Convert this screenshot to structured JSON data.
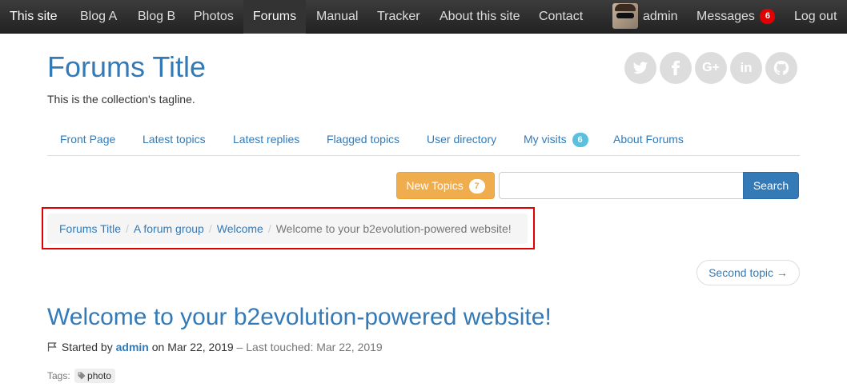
{
  "navbar": {
    "brand": "This site",
    "items": [
      "Blog A",
      "Blog B",
      "Photos",
      "Forums",
      "Manual",
      "Tracker",
      "About this site",
      "Contact"
    ],
    "active": "Forums",
    "user": "admin",
    "messages_label": "Messages",
    "messages_count": "6",
    "logout": "Log out"
  },
  "header": {
    "title": "Forums Title",
    "tagline": "This is the collection's tagline.",
    "social": [
      "twitter-icon",
      "facebook-icon",
      "google-plus-icon",
      "linkedin-icon",
      "github-icon"
    ]
  },
  "tabs": {
    "items": [
      "Front Page",
      "Latest topics",
      "Latest replies",
      "Flagged topics",
      "User directory",
      "My visits",
      "About Forums"
    ],
    "my_visits_count": "6"
  },
  "search": {
    "new_topics_label": "New Topics",
    "new_topics_count": "7",
    "placeholder": "",
    "button": "Search"
  },
  "breadcrumb": {
    "items": [
      "Forums Title",
      "A forum group",
      "Welcome"
    ],
    "current": "Welcome to your b2evolution-powered website!"
  },
  "pager": {
    "next": "Second topic →"
  },
  "post": {
    "title": "Welcome to your b2evolution-powered website!",
    "started_by": "Started by",
    "author": "admin",
    "on": "on Mar 22, 2019",
    "last_touched": "– Last touched: Mar 22, 2019",
    "tags_label": "Tags:",
    "tags": [
      "photo"
    ]
  },
  "colors": {
    "link": "#337ab7",
    "warning": "#f0ad4e",
    "highlight_box": "#e00000",
    "badge_red": "#e40000",
    "badge_blue": "#5bc0de"
  }
}
